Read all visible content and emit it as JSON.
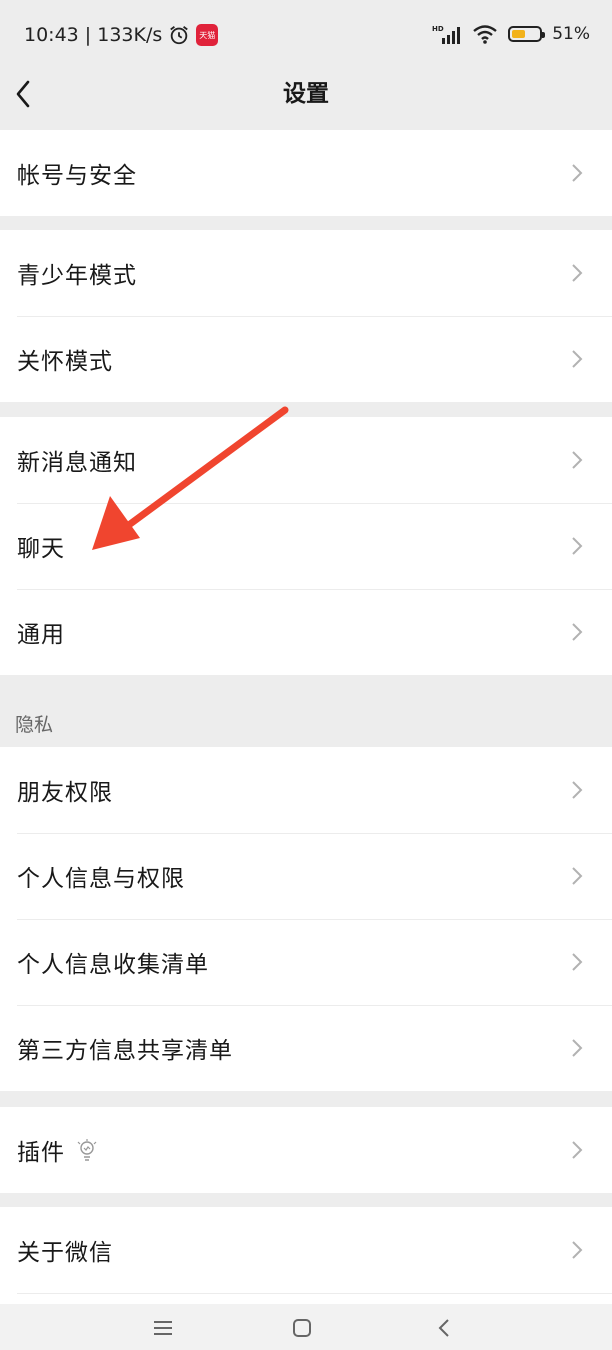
{
  "status_bar": {
    "time_speed": "10:43 | 133K/s",
    "network": "HD",
    "battery_percent": "51%",
    "battery_level": 0.51,
    "app_badge": "天猫"
  },
  "header": {
    "title": "设置"
  },
  "groups": [
    {
      "items": [
        {
          "label": "帐号与安全"
        }
      ]
    },
    {
      "items": [
        {
          "label": "青少年模式"
        },
        {
          "label": "关怀模式"
        }
      ]
    },
    {
      "items": [
        {
          "label": "新消息通知"
        },
        {
          "label": "聊天"
        },
        {
          "label": "通用"
        }
      ]
    },
    {
      "header": "隐私",
      "items": [
        {
          "label": "朋友权限"
        },
        {
          "label": "个人信息与权限"
        },
        {
          "label": "个人信息收集清单"
        },
        {
          "label": "第三方信息共享清单"
        }
      ]
    },
    {
      "items": [
        {
          "label": "插件",
          "icon": "lightbulb-icon"
        }
      ]
    },
    {
      "items": [
        {
          "label": "关于微信"
        }
      ]
    }
  ],
  "annotation": {
    "color": "#f0452f"
  },
  "colors": {
    "background": "#ededed",
    "surface": "#ffffff",
    "text": "#191919",
    "chevron": "#b2b2b2"
  }
}
